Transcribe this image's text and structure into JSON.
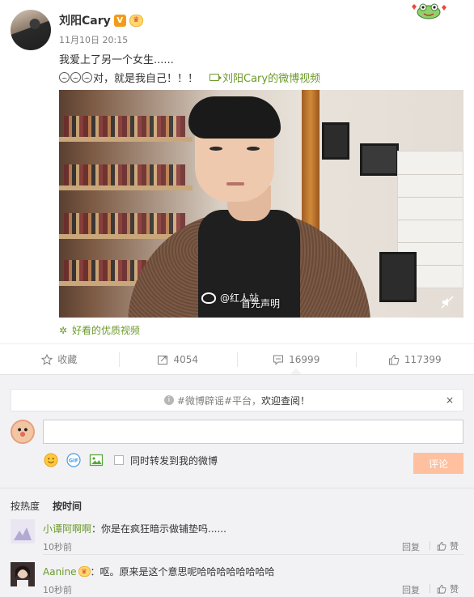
{
  "post": {
    "author": "刘阳Cary",
    "verified_badge": "V",
    "time": "11月10日 20:15",
    "line1": "我爱上了另一个女生......",
    "line2": "对，就是我自己！！！",
    "video_link": "刘阳Cary的微博视频",
    "quality_label": "好看的优质视频"
  },
  "video": {
    "watermark": "@红人站",
    "caption": "首先声明"
  },
  "actions": [
    {
      "label": "收藏",
      "icon": "star-icon"
    },
    {
      "label": "4054",
      "icon": "repost-icon"
    },
    {
      "label": "16999",
      "icon": "comment-icon"
    },
    {
      "label": "117399",
      "icon": "thumbs-up-icon"
    }
  ],
  "notice": {
    "prefix": "#微博辟谣#平台，",
    "welcome": "欢迎查阅！",
    "close": "×"
  },
  "composer": {
    "placeholder": "",
    "forward_label": "同时转发到我的微博",
    "submit_label": "评论"
  },
  "sort": {
    "hot": "按热度",
    "time": "按时间"
  },
  "comments": [
    {
      "user": "小谭阿啊啊",
      "text": "：你是在疯狂暗示做铺垫吗......",
      "time": "10秒前",
      "reply": "回复",
      "like": "赞"
    },
    {
      "user": "Aanine",
      "text": "：呕。原来是这个意思呢哈哈哈哈哈哈哈哈",
      "time": "10秒前",
      "reply": "回复",
      "like": "赞"
    }
  ],
  "colors": {
    "accent_green": "#6b9a2a",
    "submit_disabled": "#ffc09f",
    "verified_orange": "#f29b1a",
    "comment_bg": "#f2f2f5"
  }
}
